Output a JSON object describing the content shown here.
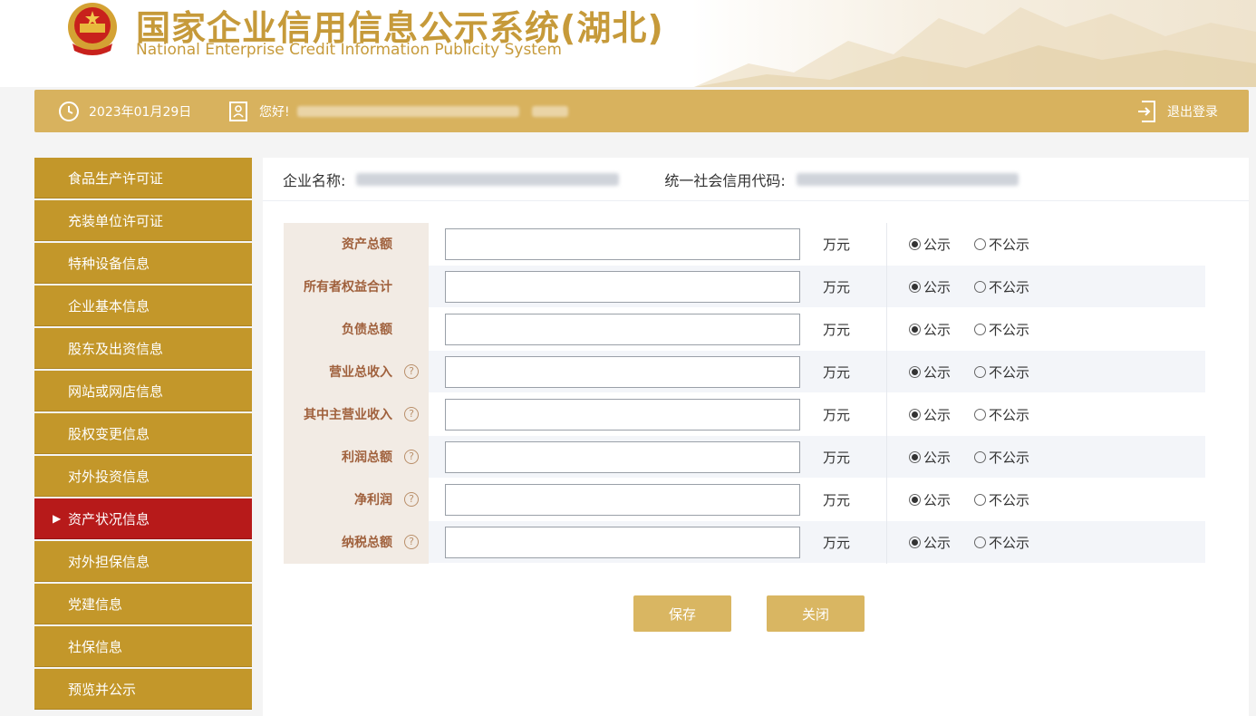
{
  "header": {
    "title_cn": "国家企业信用信息公示系统(湖北)",
    "title_en": "National Enterprise Credit Information Publicity System"
  },
  "infobar": {
    "date": "2023年01月29日",
    "greeting": "您好!",
    "logout": "退出登录"
  },
  "sidebar": {
    "items": [
      {
        "label": "食品生产许可证"
      },
      {
        "label": "充装单位许可证"
      },
      {
        "label": "特种设备信息"
      },
      {
        "label": "企业基本信息"
      },
      {
        "label": "股东及出资信息"
      },
      {
        "label": "网站或网店信息"
      },
      {
        "label": "股权变更信息"
      },
      {
        "label": "对外投资信息"
      },
      {
        "label": "资产状况信息"
      },
      {
        "label": "对外担保信息"
      },
      {
        "label": "党建信息"
      },
      {
        "label": "社保信息"
      },
      {
        "label": "预览并公示"
      }
    ],
    "active_index": 8
  },
  "company": {
    "name_label": "企业名称:",
    "code_label": "统一社会信用代码:"
  },
  "form": {
    "unit": "万元",
    "public_label": "公示",
    "private_label": "不公示",
    "help_symbol": "?",
    "rows": [
      {
        "label": "资产总额",
        "help": false,
        "value": "",
        "public": true
      },
      {
        "label": "所有者权益合计",
        "help": false,
        "value": "",
        "public": true
      },
      {
        "label": "负债总额",
        "help": false,
        "value": "",
        "public": true
      },
      {
        "label": "营业总收入",
        "help": true,
        "value": "",
        "public": true
      },
      {
        "label": "其中主营业收入",
        "help": true,
        "value": "",
        "public": true
      },
      {
        "label": "利润总额",
        "help": true,
        "value": "",
        "public": true
      },
      {
        "label": "净利润",
        "help": true,
        "value": "",
        "public": true
      },
      {
        "label": "纳税总额",
        "help": true,
        "value": "",
        "public": true
      }
    ]
  },
  "buttons": {
    "save": "保存",
    "close": "关闭"
  },
  "colors": {
    "gold": "#c69a3a",
    "bar": "#d8b25e",
    "sidebar": "#c3972a",
    "active": "#b71a1a",
    "label_text": "#a0613d"
  }
}
